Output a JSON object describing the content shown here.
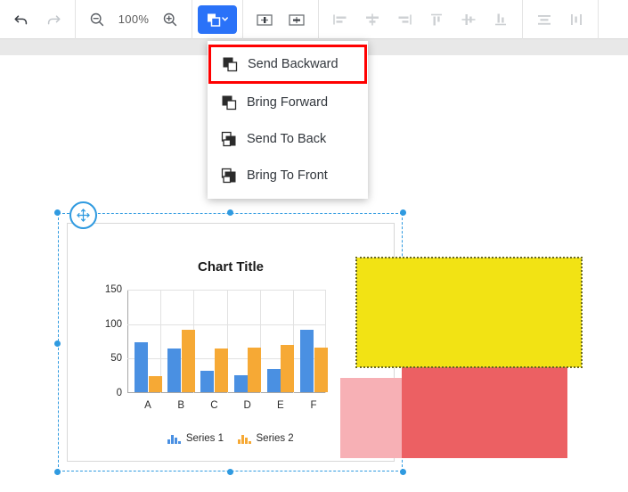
{
  "toolbar": {
    "undo": {
      "label": "Undo",
      "icon": "undo-icon",
      "enabled": true
    },
    "redo": {
      "label": "Redo",
      "icon": "redo-icon",
      "enabled": false
    },
    "zoom_out": {
      "label": "Zoom Out",
      "icon": "zoom-out-icon"
    },
    "zoom_level": "100%",
    "zoom_in": {
      "label": "Zoom In",
      "icon": "zoom-in-icon"
    },
    "arrange": {
      "label": "Arrange",
      "icon": "arrange-icon",
      "active": true,
      "accent": "#2a72f8"
    },
    "group": {
      "label": "Group",
      "icon": "group-icon"
    },
    "ungroup": {
      "label": "Ungroup",
      "icon": "ungroup-icon"
    },
    "align_left": {
      "label": "Align Left",
      "icon": "align-left-icon",
      "enabled": false
    },
    "align_center": {
      "label": "Align Center",
      "icon": "align-center-icon",
      "enabled": false
    },
    "align_right": {
      "label": "Align Right",
      "icon": "align-right-icon",
      "enabled": false
    },
    "align_top": {
      "label": "Align Top",
      "icon": "align-top-icon",
      "enabled": false
    },
    "align_middle": {
      "label": "Align Middle",
      "icon": "align-middle-icon",
      "enabled": false
    },
    "align_bottom": {
      "label": "Align Bottom",
      "icon": "align-bottom-icon",
      "enabled": false
    },
    "distribute_vertical": {
      "label": "Distribute Vertically",
      "icon": "distribute-vertical-icon",
      "enabled": false
    },
    "distribute_horizontal": {
      "label": "Distribute Horizontally",
      "icon": "distribute-horizontal-icon",
      "enabled": false
    }
  },
  "menu": {
    "highlight_color": "#ff0000",
    "items": [
      {
        "label": "Send Backward",
        "icon": "send-backward-icon",
        "highlighted": true
      },
      {
        "label": "Bring Forward",
        "icon": "bring-forward-icon",
        "highlighted": false
      },
      {
        "label": "Send To Back",
        "icon": "send-to-back-icon",
        "highlighted": false
      },
      {
        "label": "Bring To Front",
        "icon": "bring-to-front-icon",
        "highlighted": false
      }
    ]
  },
  "selection": {
    "move_handle_icon": "move-icon",
    "handle_color": "#2f9ae0"
  },
  "shapes": [
    {
      "name": "pink-rectangle",
      "color": "#f7b0b5"
    },
    {
      "name": "red-rectangle",
      "color": "#ec6063"
    },
    {
      "name": "yellow-rectangle",
      "color": "#f2e314",
      "selected": true
    }
  ],
  "chart_data": {
    "type": "bar",
    "title": "Chart Title",
    "categories": [
      "A",
      "B",
      "C",
      "D",
      "E",
      "F"
    ],
    "series": [
      {
        "name": "Series 1",
        "color": "#4a90e2",
        "values": [
          72,
          64,
          31,
          25,
          34,
          90
        ]
      },
      {
        "name": "Series 2",
        "color": "#f6a935",
        "values": [
          23,
          91,
          64,
          65,
          68,
          65
        ]
      }
    ],
    "ylim": [
      0,
      150
    ],
    "yticks": [
      0,
      50,
      100,
      150
    ],
    "xlabel": "",
    "ylabel": "",
    "grid": true,
    "legend_position": "bottom"
  }
}
